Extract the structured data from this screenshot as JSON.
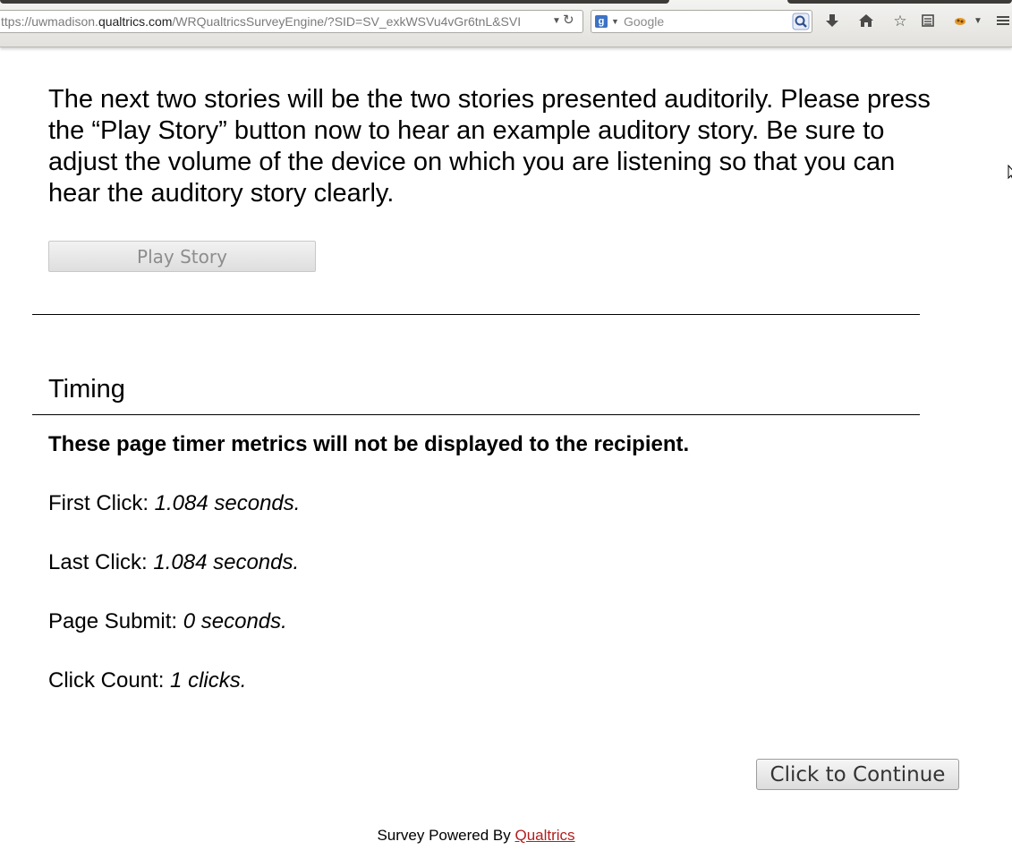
{
  "browser": {
    "url_prefix": "ttps://uwmadison.",
    "url_host": "qualtrics.com",
    "url_path": "/WRQualtricsSurveyEngine/?SID=SV_exkWSVu4vGr6tnL&SVI",
    "search_engine_icon": "g",
    "search_placeholder": "Google",
    "icons": [
      "dropdown-icon",
      "reload-icon",
      "search-icon",
      "download-icon",
      "home-icon",
      "bookmark-star-icon",
      "reading-list-icon",
      "addon-icon",
      "menu-icon"
    ]
  },
  "question": {
    "text": "The next two stories will be the two stories presented auditorily. Please press the “Play Story” button now to hear an example auditory story. Be sure to adjust the volume of the device on which you are listening so that you can hear the auditory story clearly.",
    "play_button_label": "Play Story"
  },
  "timing": {
    "title": "Timing",
    "note": "These page timer metrics will not be displayed to the recipient.",
    "metrics": [
      {
        "label": "First Click: ",
        "value": "1.084 seconds."
      },
      {
        "label": "Last Click: ",
        "value": "1.084 seconds."
      },
      {
        "label": "Page Submit: ",
        "value": "0 seconds."
      },
      {
        "label": "Click Count: ",
        "value": "1 clicks."
      }
    ]
  },
  "navigation": {
    "continue_label": "Click to Continue"
  },
  "footer": {
    "prefix": "Survey Powered By ",
    "link_text": "Qualtrics"
  }
}
